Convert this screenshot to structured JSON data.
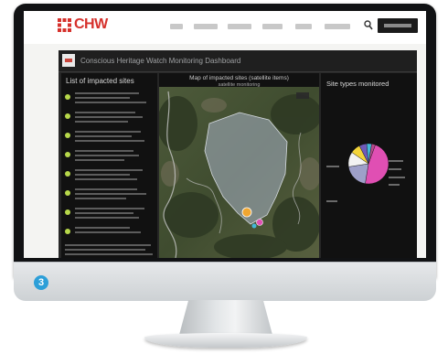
{
  "figure_label": "3",
  "site": {
    "logo_text": "CHW",
    "nav": [
      {
        "label": "",
        "has_dropdown": false
      },
      {
        "label": "",
        "has_dropdown": true
      },
      {
        "label": "",
        "has_dropdown": true
      },
      {
        "label": "",
        "has_dropdown": true
      },
      {
        "label": "",
        "has_dropdown": false
      },
      {
        "label": "",
        "has_dropdown": true
      }
    ],
    "search_icon": "search-icon",
    "subscribe_label": ""
  },
  "dashboard": {
    "title": "Conscious Heritage Watch Monitoring Dashboard",
    "sites_panel": {
      "title": "List of impacted sites",
      "items": [
        {
          "text": ""
        },
        {
          "text": ""
        },
        {
          "text": ""
        },
        {
          "text": ""
        },
        {
          "text": ""
        },
        {
          "text": ""
        },
        {
          "text": ""
        },
        {
          "text": ""
        }
      ],
      "footer_note": ""
    },
    "map_panel": {
      "title_line1": "Map of impacted sites (satellite items)",
      "title_line2": "satellite monitoring"
    },
    "pie_panel": {
      "title": "Site types monitored"
    }
  },
  "chart_data": {
    "type": "pie",
    "title": "Site types monitored",
    "slices": [
      {
        "label": "",
        "value": 47,
        "color": "#e04fb3"
      },
      {
        "label": "",
        "value": 20,
        "color": "#9ea0c9"
      },
      {
        "label": "",
        "value": 12,
        "color": "#f2f2f2"
      },
      {
        "label": "",
        "value": 8,
        "color": "#f3d43a"
      },
      {
        "label": "",
        "value": 6,
        "color": "#6f5ab8"
      },
      {
        "label": "",
        "value": 4,
        "color": "#43b8d8"
      },
      {
        "label": "",
        "value": 3,
        "color": "#b54a8a"
      }
    ]
  },
  "colors": {
    "brand": "#d6312c",
    "dashboard_bg": "#262626",
    "panel_bg": "#111111",
    "bullet": "#b7d84a",
    "badge": "#2d9fd8"
  }
}
